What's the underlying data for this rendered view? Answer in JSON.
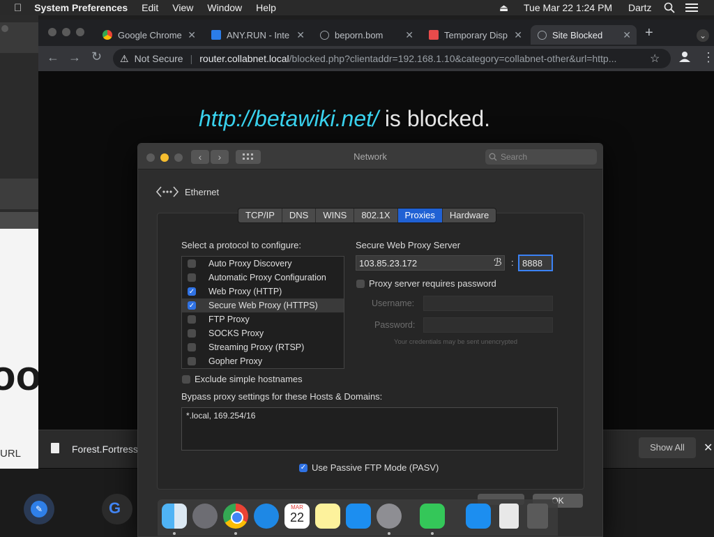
{
  "menubar": {
    "app": "System Preferences",
    "items": [
      "Edit",
      "View",
      "Window",
      "Help"
    ],
    "datetime": "Tue Mar 22  1:24 PM",
    "user": "Dartz"
  },
  "browser": {
    "tabs": [
      {
        "label": "Google Chrome"
      },
      {
        "label": "ANY.RUN - Inte"
      },
      {
        "label": "beporn.bom"
      },
      {
        "label": "Temporary Disp"
      },
      {
        "label": "Site Blocked"
      }
    ],
    "security_label": "Not Secure",
    "url_host": "router.collabnet.local",
    "url_path": "/blocked.php?clientaddr=192.168.1.10&category=collabnet-other&url=http...",
    "page": {
      "blocked_url": "http://betawiki.net/",
      "blocked_suffix": " is blocked."
    }
  },
  "download_bar": {
    "filename": "Forest.Fortress",
    "show_all": "Show All"
  },
  "background_window": {
    "partial_text": "URL"
  },
  "dialog": {
    "title": "Network",
    "search_placeholder": "Search",
    "interface": "Ethernet",
    "tabs": [
      "TCP/IP",
      "DNS",
      "WINS",
      "802.1X",
      "Proxies",
      "Hardware"
    ],
    "active_tab": "Proxies",
    "select_protocol_label": "Select a protocol to configure:",
    "protocols": [
      {
        "label": "Auto Proxy Discovery",
        "checked": false
      },
      {
        "label": "Automatic Proxy Configuration",
        "checked": false
      },
      {
        "label": "Web Proxy (HTTP)",
        "checked": true
      },
      {
        "label": "Secure Web Proxy (HTTPS)",
        "checked": true
      },
      {
        "label": "FTP Proxy",
        "checked": false
      },
      {
        "label": "SOCKS Proxy",
        "checked": false
      },
      {
        "label": "Streaming Proxy (RTSP)",
        "checked": false
      },
      {
        "label": "Gopher Proxy",
        "checked": false
      }
    ],
    "server_label": "Secure Web Proxy Server",
    "server": "103.85.23.172",
    "port_sep": ":",
    "port": "8888",
    "requires_password_label": "Proxy server requires password",
    "username_label": "Username:",
    "password_label": "Password:",
    "credentials_note": "Your credentials may be sent unencrypted",
    "exclude_label": "Exclude simple hostnames",
    "bypass_label": "Bypass proxy settings for these Hosts & Domains:",
    "bypass_value": "*.local, 169.254/16",
    "passive_ftp_label": "Use Passive FTP Mode (PASV)",
    "ok_label": "OK"
  },
  "dock": {
    "calendar_month": "MAR",
    "calendar_day": "22"
  },
  "colors": {
    "accent": "#2061d4",
    "blocked_url": "#3ad4f0"
  }
}
